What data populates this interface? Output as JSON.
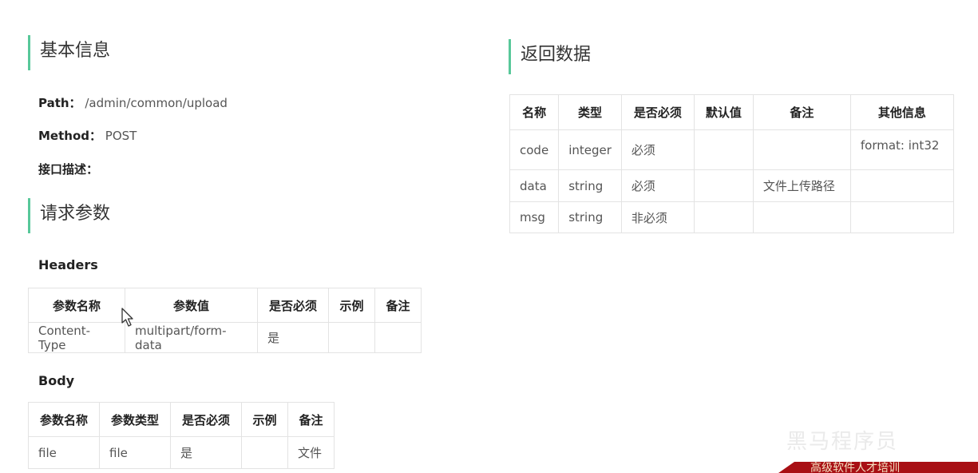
{
  "basic_info": {
    "title": "基本信息",
    "path_label": "Path：",
    "path_value": "/admin/common/upload",
    "method_label": "Method：",
    "method_value": "POST",
    "desc_label": "接口描述："
  },
  "request_params": {
    "title": "请求参数",
    "headers_label": "Headers",
    "headers_table": {
      "columns": [
        "参数名称",
        "参数值",
        "是否必须",
        "示例",
        "备注"
      ],
      "rows": [
        [
          "Content-Type",
          "multipart/form-data",
          "是",
          "",
          ""
        ]
      ]
    },
    "body_label": "Body",
    "body_table": {
      "columns": [
        "参数名称",
        "参数类型",
        "是否必须",
        "示例",
        "备注"
      ],
      "rows": [
        [
          "file",
          "file",
          "是",
          "",
          "文件"
        ]
      ]
    }
  },
  "return_data": {
    "title": "返回数据",
    "table": {
      "columns": [
        "名称",
        "类型",
        "是否必须",
        "默认值",
        "备注",
        "其他信息"
      ],
      "rows": [
        [
          "code",
          "integer",
          "必须",
          "",
          "",
          "format: int32"
        ],
        [
          "data",
          "string",
          "必须",
          "",
          "文件上传路径",
          ""
        ],
        [
          "msg",
          "string",
          "非必须",
          "",
          "",
          ""
        ]
      ]
    }
  },
  "watermark": {
    "text": "黑马程序员",
    "bar_text": "高级软件人才培训"
  },
  "colors": {
    "accent": "#58c89a",
    "border": "#e3e3e3",
    "watermark_bar": "#a80f14"
  }
}
